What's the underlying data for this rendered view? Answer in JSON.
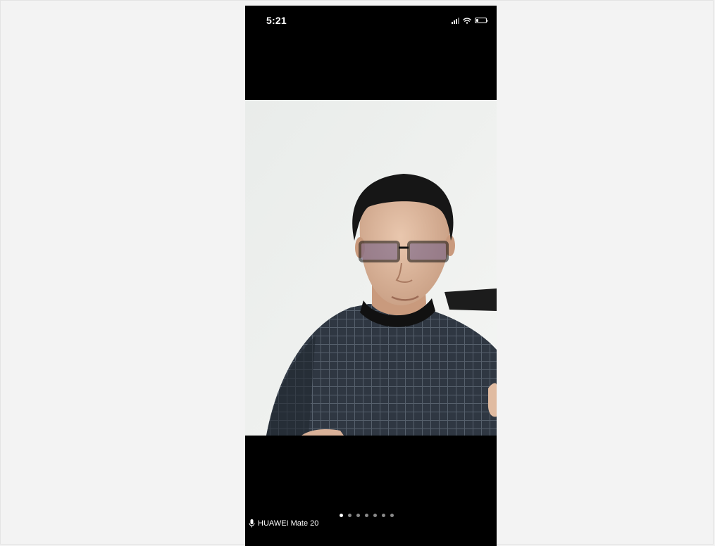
{
  "status_bar": {
    "time": "5:21",
    "icons": [
      "cellular-signal-icon",
      "wifi-icon",
      "battery-icon"
    ],
    "battery_level": 0.25
  },
  "video": {
    "content": "participant-video-feed"
  },
  "participant": {
    "name": "HUAWEI Mate 20",
    "mic_icon": "microphone-icon"
  },
  "pagination": {
    "page_count": 7,
    "active_index": 0
  },
  "colors": {
    "page_background": "#f3f3f3",
    "phone_background": "#000000",
    "text": "#ffffff",
    "dot_inactive": "#8a8a8a",
    "dot_active": "#ffffff"
  }
}
